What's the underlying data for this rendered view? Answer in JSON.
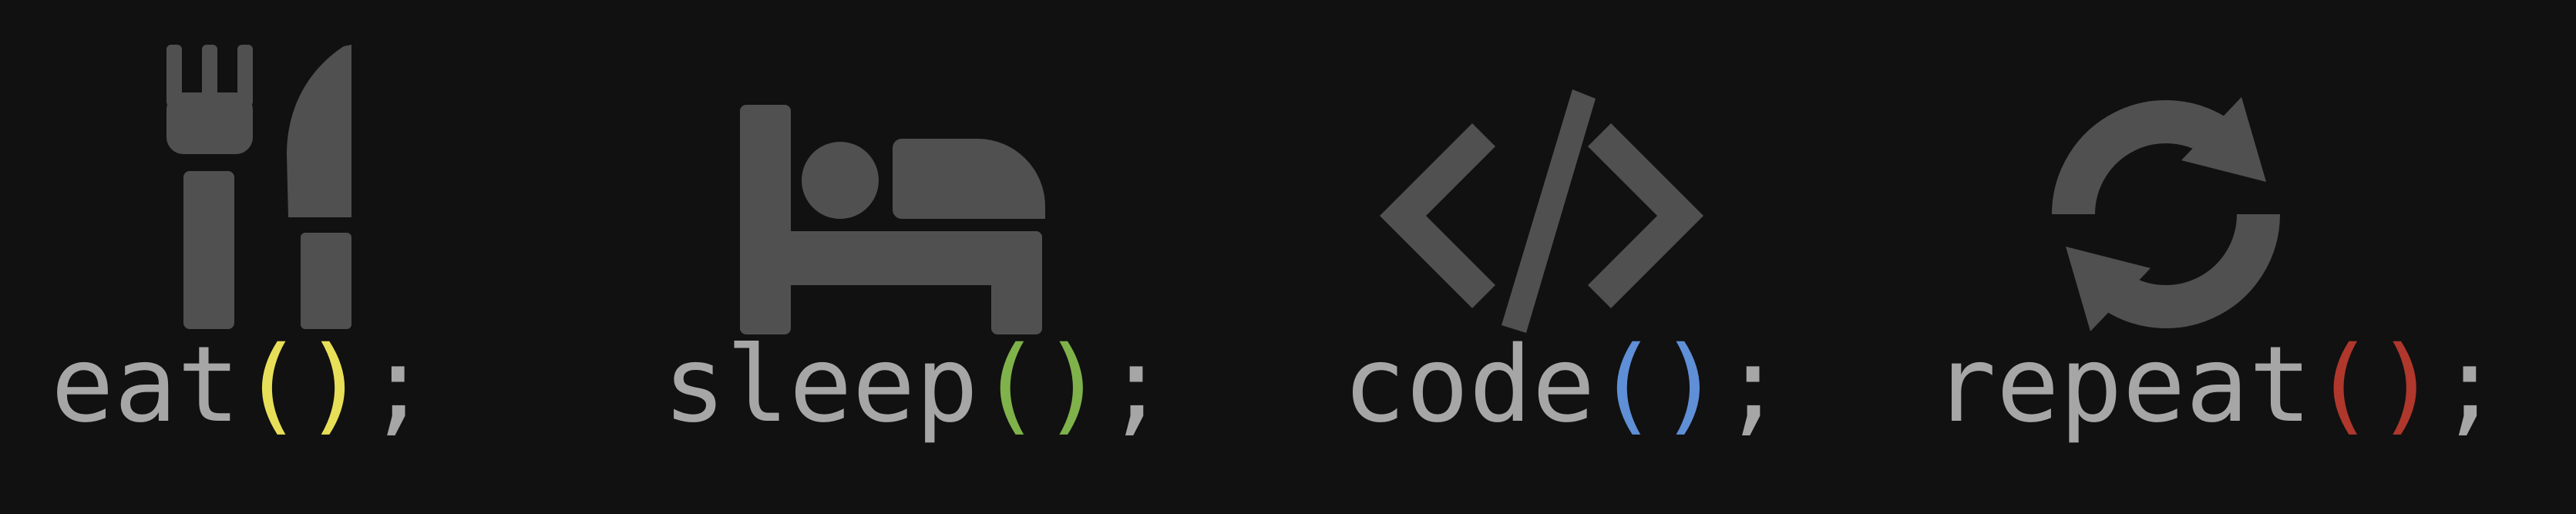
{
  "colors": {
    "background": "#111111",
    "icon": "#505050",
    "text": "#a6a6a6"
  },
  "items": [
    {
      "name": "eat",
      "icon": "fork-knife-icon",
      "paren_color": "#e7df57"
    },
    {
      "name": "sleep",
      "icon": "bed-icon",
      "paren_color": "#7fb24a"
    },
    {
      "name": "code",
      "icon": "code-icon",
      "paren_color": "#5f8fd6"
    },
    {
      "name": "repeat",
      "icon": "repeat-icon",
      "paren_color": "#b0372c"
    }
  ],
  "punctuation": {
    "open": "(",
    "close": ")",
    "end": ";"
  }
}
